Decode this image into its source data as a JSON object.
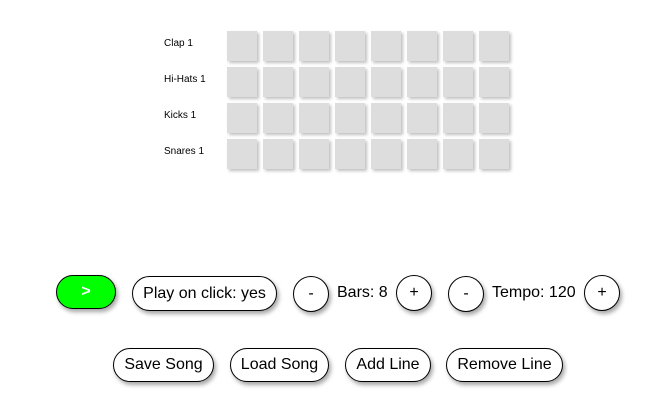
{
  "tracks": [
    {
      "name": "Clap 1"
    },
    {
      "name": "Hi-Hats 1"
    },
    {
      "name": "Kicks 1"
    },
    {
      "name": "Snares 1"
    }
  ],
  "steps_per_track": 8,
  "cell_color": "#dddddd",
  "controls": {
    "play_label": ">",
    "play_color": "#00ff00",
    "play_on_click_label": "Play on click: yes",
    "bars_minus": "-",
    "bars_label": "Bars: 8",
    "bars_plus": "+",
    "tempo_minus": "-",
    "tempo_label": "Tempo: 120",
    "tempo_plus": "+"
  },
  "actions": {
    "save_label": "Save Song",
    "load_label": "Load Song",
    "add_line_label": "Add Line",
    "remove_line_label": "Remove Line"
  }
}
